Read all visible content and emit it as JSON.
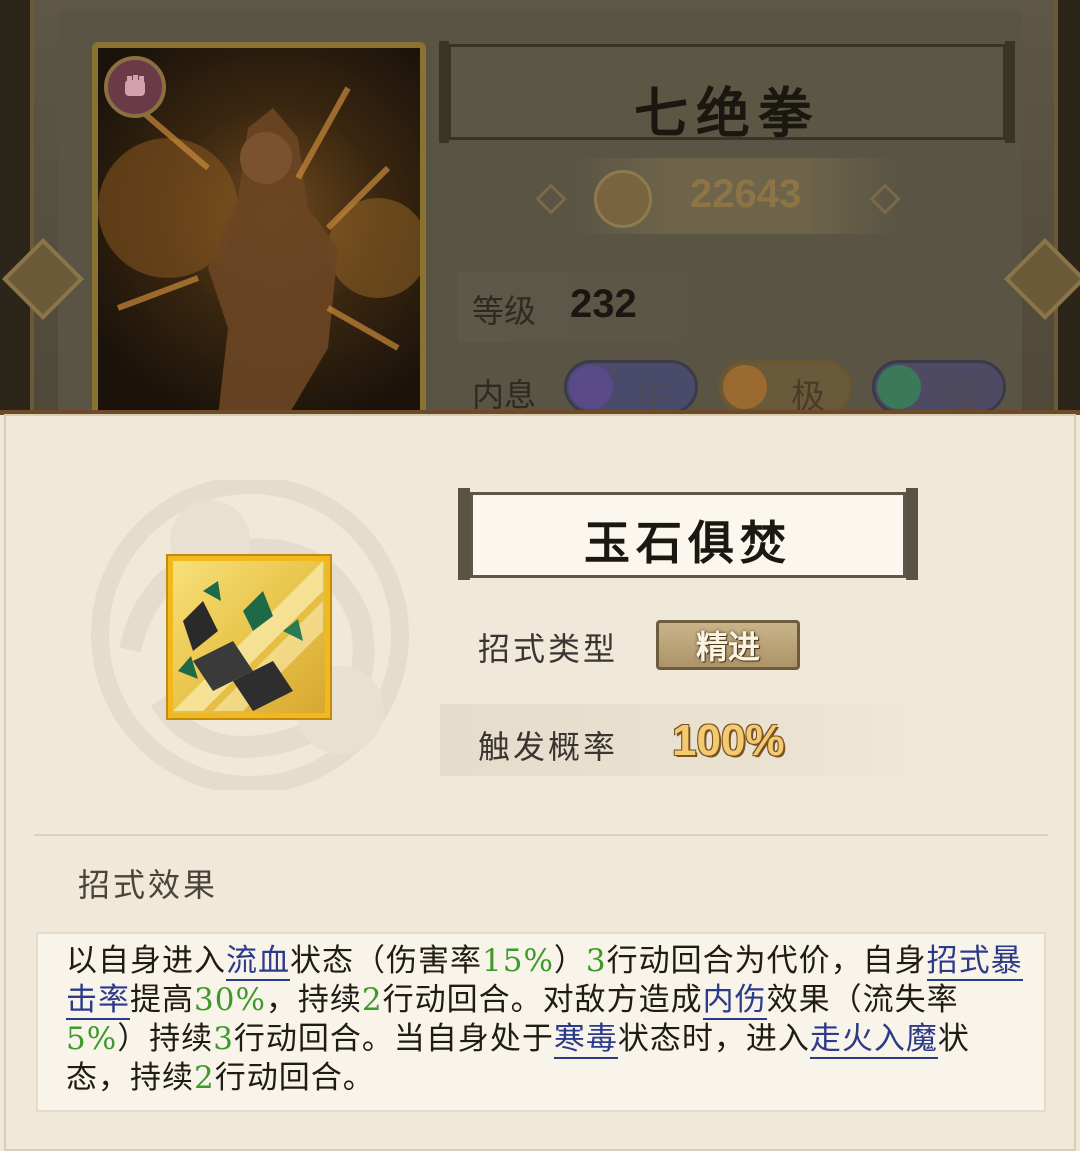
{
  "hero": {
    "name": "七绝拳",
    "power": "22643",
    "level_label": "等级",
    "level": "232",
    "inner_label": "内息",
    "inner_pills": [
      {
        "label": "中",
        "orb_color": "#5a4a8a"
      },
      {
        "label": "极",
        "orb_color": "#9a6a30"
      },
      {
        "label": "强",
        "orb_color": "#3a7a5a"
      }
    ]
  },
  "dialog": {
    "title": "玉石俱焚",
    "type_label": "招式类型",
    "type_value": "精进",
    "prob_label": "触发概率",
    "prob_value": "100%",
    "effect_label": "招式效果",
    "effect": {
      "t1": "以自身进入",
      "k1": "流血",
      "t2": "状态（伤害率",
      "n1": "15%",
      "t3": "）",
      "n2": "3",
      "t4": "行动回合为代价，自身",
      "k2": "招式暴击率",
      "t5": "提高",
      "n3": "30%",
      "t6": "，持续",
      "n4": "2",
      "t7": "行动回合。对敌方造成",
      "k3": "内伤",
      "t8": "效果（流失率",
      "n5": "5%",
      "t9": "）持续",
      "n6": "3",
      "t10": "行动回合。当自身处于",
      "k4": "寒毒",
      "t11": "状态时，进入",
      "k5": "走火入魔",
      "t12": "状态，持续",
      "n7": "2",
      "t13": "行动回合。"
    }
  },
  "colors": {
    "dialog_bg": "#f0e8d8",
    "keyword": "#2c3a8a",
    "number": "#3c9a2a",
    "icon_frame": "#f1b91c"
  }
}
